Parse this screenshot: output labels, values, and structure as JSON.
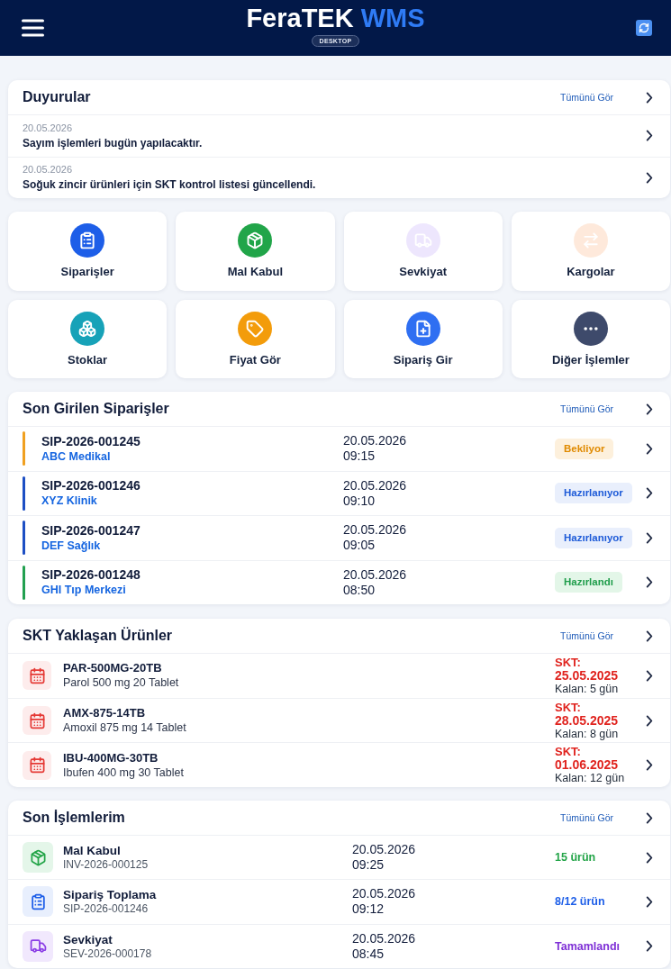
{
  "header": {
    "title": "FeraTEK",
    "title_accent": "WMS",
    "badge": "DESKTOP"
  },
  "announcements": {
    "title": "Duyurular",
    "view_all": "Tümünü Gör",
    "items": [
      {
        "date": "20.05.2026",
        "text": "Sayım işlemleri bugün yapılacaktır."
      },
      {
        "date": "20.05.2026",
        "text": "Soğuk zincir ürünleri için SKT kontrol listesi güncellendi."
      }
    ]
  },
  "shortcuts": [
    {
      "label": "Siparişler",
      "kind": "orders",
      "disabled": false
    },
    {
      "label": "Mal Kabul",
      "kind": "receiving",
      "disabled": false
    },
    {
      "label": "Sevkiyat",
      "kind": "shipping",
      "disabled": true
    },
    {
      "label": "Kargolar",
      "kind": "cargo",
      "disabled": true
    },
    {
      "label": "Stoklar",
      "kind": "stock",
      "disabled": false
    },
    {
      "label": "Fiyat Gör",
      "kind": "price",
      "disabled": false
    },
    {
      "label": "Sipariş Gir",
      "kind": "new_order",
      "disabled": false
    },
    {
      "label": "Diğer İşlemler",
      "kind": "more",
      "disabled": false
    }
  ],
  "recent_orders": {
    "title": "Son Girilen Siparişler",
    "view_all": "Tümünü Gör",
    "rows": [
      {
        "order_no": "SIP-2026-001245",
        "customer": "ABC Medikal",
        "date": "20.05.2026",
        "time": "09:15",
        "status": "Bekliyor",
        "kind": "pending"
      },
      {
        "order_no": "SIP-2026-001246",
        "customer": "XYZ Klinik",
        "date": "20.05.2026",
        "time": "09:10",
        "status": "Hazırlanıyor",
        "kind": "preparing"
      },
      {
        "order_no": "SIP-2026-001247",
        "customer": "DEF Sağlık",
        "date": "20.05.2026",
        "time": "09:05",
        "status": "Hazırlanıyor",
        "kind": "preparing"
      },
      {
        "order_no": "SIP-2026-001248",
        "customer": "GHI Tıp Merkezi",
        "date": "20.05.2026",
        "time": "08:50",
        "status": "Hazırlandı",
        "kind": "ready"
      }
    ]
  },
  "expiring": {
    "title": "SKT Yaklaşan Ürünler",
    "view_all": "Tümünü Gör",
    "rows": [
      {
        "code": "PAR-500MG-20TB",
        "name": "Parol 500 mg 20 Tablet",
        "label": "SKT:",
        "date": "25.05.2025",
        "remaining": "Kalan: 5 gün"
      },
      {
        "code": "AMX-875-14TB",
        "name": "Amoxil 875 mg 14 Tablet",
        "label": "SKT:",
        "date": "28.05.2025",
        "remaining": "Kalan: 8 gün"
      },
      {
        "code": "IBU-400MG-30TB",
        "name": "Ibufen 400 mg 30 Tablet",
        "label": "SKT:",
        "date": "01.06.2025",
        "remaining": "Kalan: 12 gün"
      }
    ]
  },
  "activities": {
    "title": "Son İşlemlerim",
    "view_all": "Tümünü Gör",
    "rows": [
      {
        "title": "Mal Kabul",
        "ref": "INV-2026-000125",
        "date": "20.05.2026",
        "time": "09:25",
        "result": "15 ürün",
        "kind": "receiving"
      },
      {
        "title": "Sipariş Toplama",
        "ref": "SIP-2026-001246",
        "date": "20.05.2026",
        "time": "09:12",
        "result": "8/12 ürün",
        "kind": "picking"
      },
      {
        "title": "Sevkiyat",
        "ref": "SEV-2026-000178",
        "date": "20.05.2026",
        "time": "08:45",
        "result": "Tamamlandı",
        "kind": "shipping"
      }
    ]
  }
}
